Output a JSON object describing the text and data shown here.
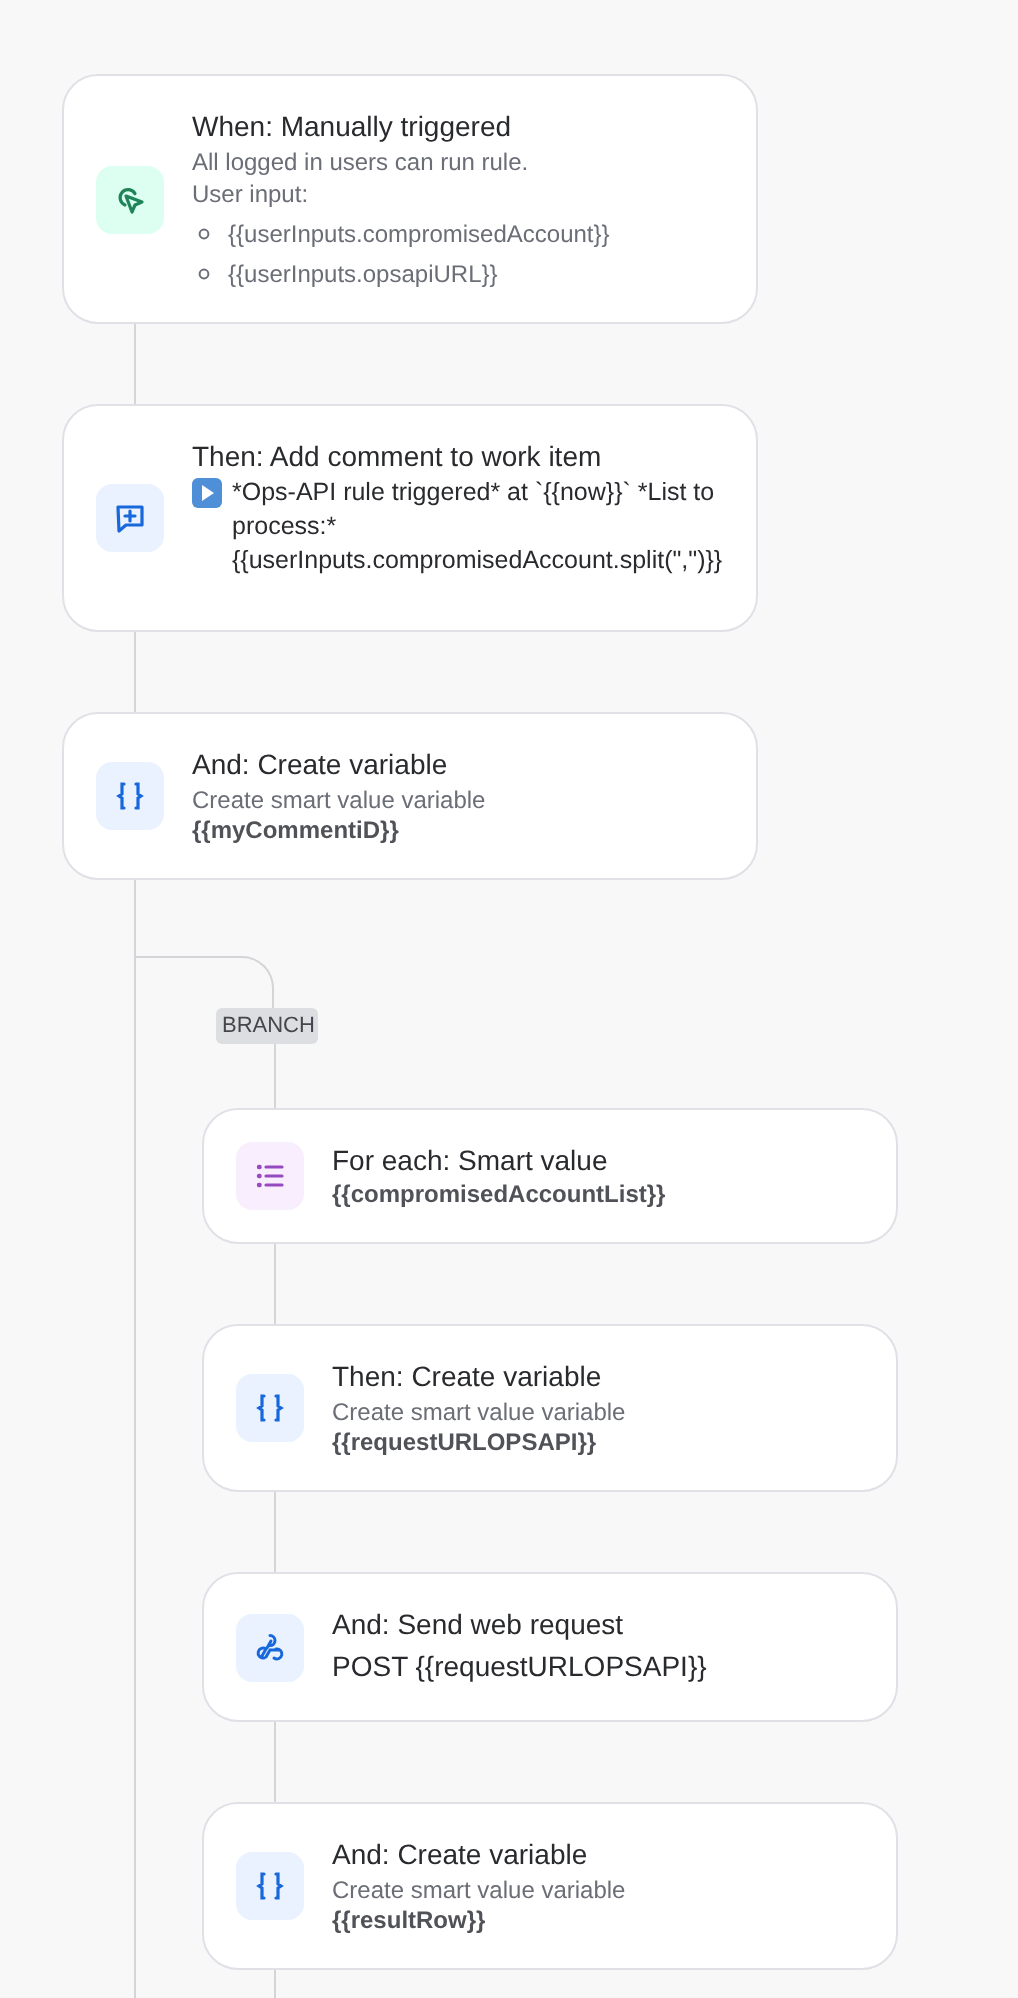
{
  "steps": [
    {
      "kind": "trigger",
      "title": "When: Manually triggered",
      "lines": [
        {
          "kind": "text",
          "text": "All logged in users can run rule."
        },
        {
          "kind": "text",
          "text": "User input:"
        },
        {
          "kind": "bullet",
          "text": "{{userInputs.compromisedAccount}}"
        },
        {
          "kind": "bullet",
          "text": "{{userInputs.opsapiURL}}"
        }
      ]
    },
    {
      "kind": "comment",
      "title": "Then: Add comment to work item",
      "lines": [
        {
          "kind": "play_body",
          "text": "*Ops-API rule triggered* at `{{now}}` *List to process:* {{userInputs.compromisedAccount.split(\",\")}}"
        }
      ]
    },
    {
      "kind": "variable",
      "title": "And: Create variable",
      "lines": [
        {
          "kind": "text",
          "text": "Create smart value variable"
        },
        {
          "kind": "bold",
          "text": "{{myCommentiD}}"
        }
      ]
    }
  ],
  "branch": {
    "label": "BRANCH",
    "steps": [
      {
        "kind": "foreach",
        "title": "For each: Smart value",
        "lines": [
          {
            "kind": "bold",
            "text": "{{compromisedAccountList}}"
          }
        ]
      },
      {
        "kind": "variable",
        "title": "Then: Create variable",
        "lines": [
          {
            "kind": "text",
            "text": "Create smart value variable"
          },
          {
            "kind": "bold",
            "text": "{{requestURLOPSAPI}}"
          }
        ]
      },
      {
        "kind": "webhook",
        "title": "And: Send web request",
        "lines": [
          {
            "kind": "body",
            "text": "POST {{requestURLOPSAPI}}"
          }
        ]
      },
      {
        "kind": "variable",
        "title": "And: Create variable",
        "lines": [
          {
            "kind": "text",
            "text": "Create smart value variable"
          },
          {
            "kind": "bold",
            "text": "{{resultRow}}"
          }
        ]
      }
    ]
  }
}
